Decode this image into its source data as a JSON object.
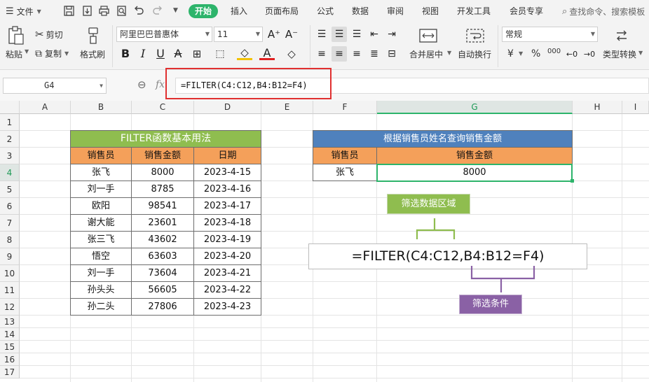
{
  "menu": {
    "file_label": "文件",
    "tabs": [
      "开始",
      "插入",
      "页面布局",
      "公式",
      "数据",
      "审阅",
      "视图",
      "开发工具",
      "会员专享"
    ],
    "search_placeholder": "查找命令、搜索模板"
  },
  "ribbon": {
    "paste": "粘贴",
    "cut": "剪切",
    "copy": "复制",
    "format_painter": "格式刷",
    "font_name": "阿里巴巴普惠体",
    "font_size": "11",
    "merge_center": "合并居中",
    "wrap_text": "自动换行",
    "number_format": "常规",
    "convert_type": "类型转换",
    "currency_symbol": "¥",
    "percent_symbol": "%",
    "thousands": "000"
  },
  "formula_bar": {
    "name_box": "G4",
    "fx": "fx",
    "formula": "=FILTER(C4:C12,B4:B12=F4)"
  },
  "columns": [
    "A",
    "B",
    "C",
    "D",
    "E",
    "F",
    "G",
    "H",
    "I"
  ],
  "rows": [
    "1",
    "2",
    "3",
    "4",
    "5",
    "6",
    "7",
    "8",
    "9",
    "10",
    "11",
    "12",
    "13",
    "14",
    "15",
    "16",
    "17"
  ],
  "selected": {
    "column": "G",
    "row": "4"
  },
  "left_table": {
    "title": "FILTER函数基本用法",
    "headers": [
      "销售员",
      "销售金额",
      "日期"
    ],
    "rows": [
      [
        "张飞",
        "8000",
        "2023-4-15"
      ],
      [
        "刘一手",
        "8785",
        "2023-4-16"
      ],
      [
        "欧阳",
        "98541",
        "2023-4-17"
      ],
      [
        "谢大能",
        "23601",
        "2023-4-18"
      ],
      [
        "张三飞",
        "43602",
        "2023-4-19"
      ],
      [
        "悟空",
        "63603",
        "2023-4-20"
      ],
      [
        "刘一手",
        "73604",
        "2023-4-21"
      ],
      [
        "孙头头",
        "56605",
        "2023-4-22"
      ],
      [
        "孙二头",
        "27806",
        "2023-4-23"
      ]
    ]
  },
  "right_table": {
    "title": "根据销售员姓名查询销售金额",
    "headers": [
      "销售员",
      "销售金额"
    ],
    "row": [
      "张飞",
      "8000"
    ]
  },
  "annotations": {
    "range_label": "筛选数据区域",
    "condition_label": "筛选条件",
    "formula_display": "=FILTER(C4:C12,B4:B12=F4)"
  },
  "colors": {
    "accent_green": "#2db46b",
    "title_green": "#8fbd4f",
    "header_orange": "#f4a05a",
    "title_blue": "#4f81bd",
    "bracket_purple": "#8a61a5",
    "highlight_red": "#e03030"
  }
}
